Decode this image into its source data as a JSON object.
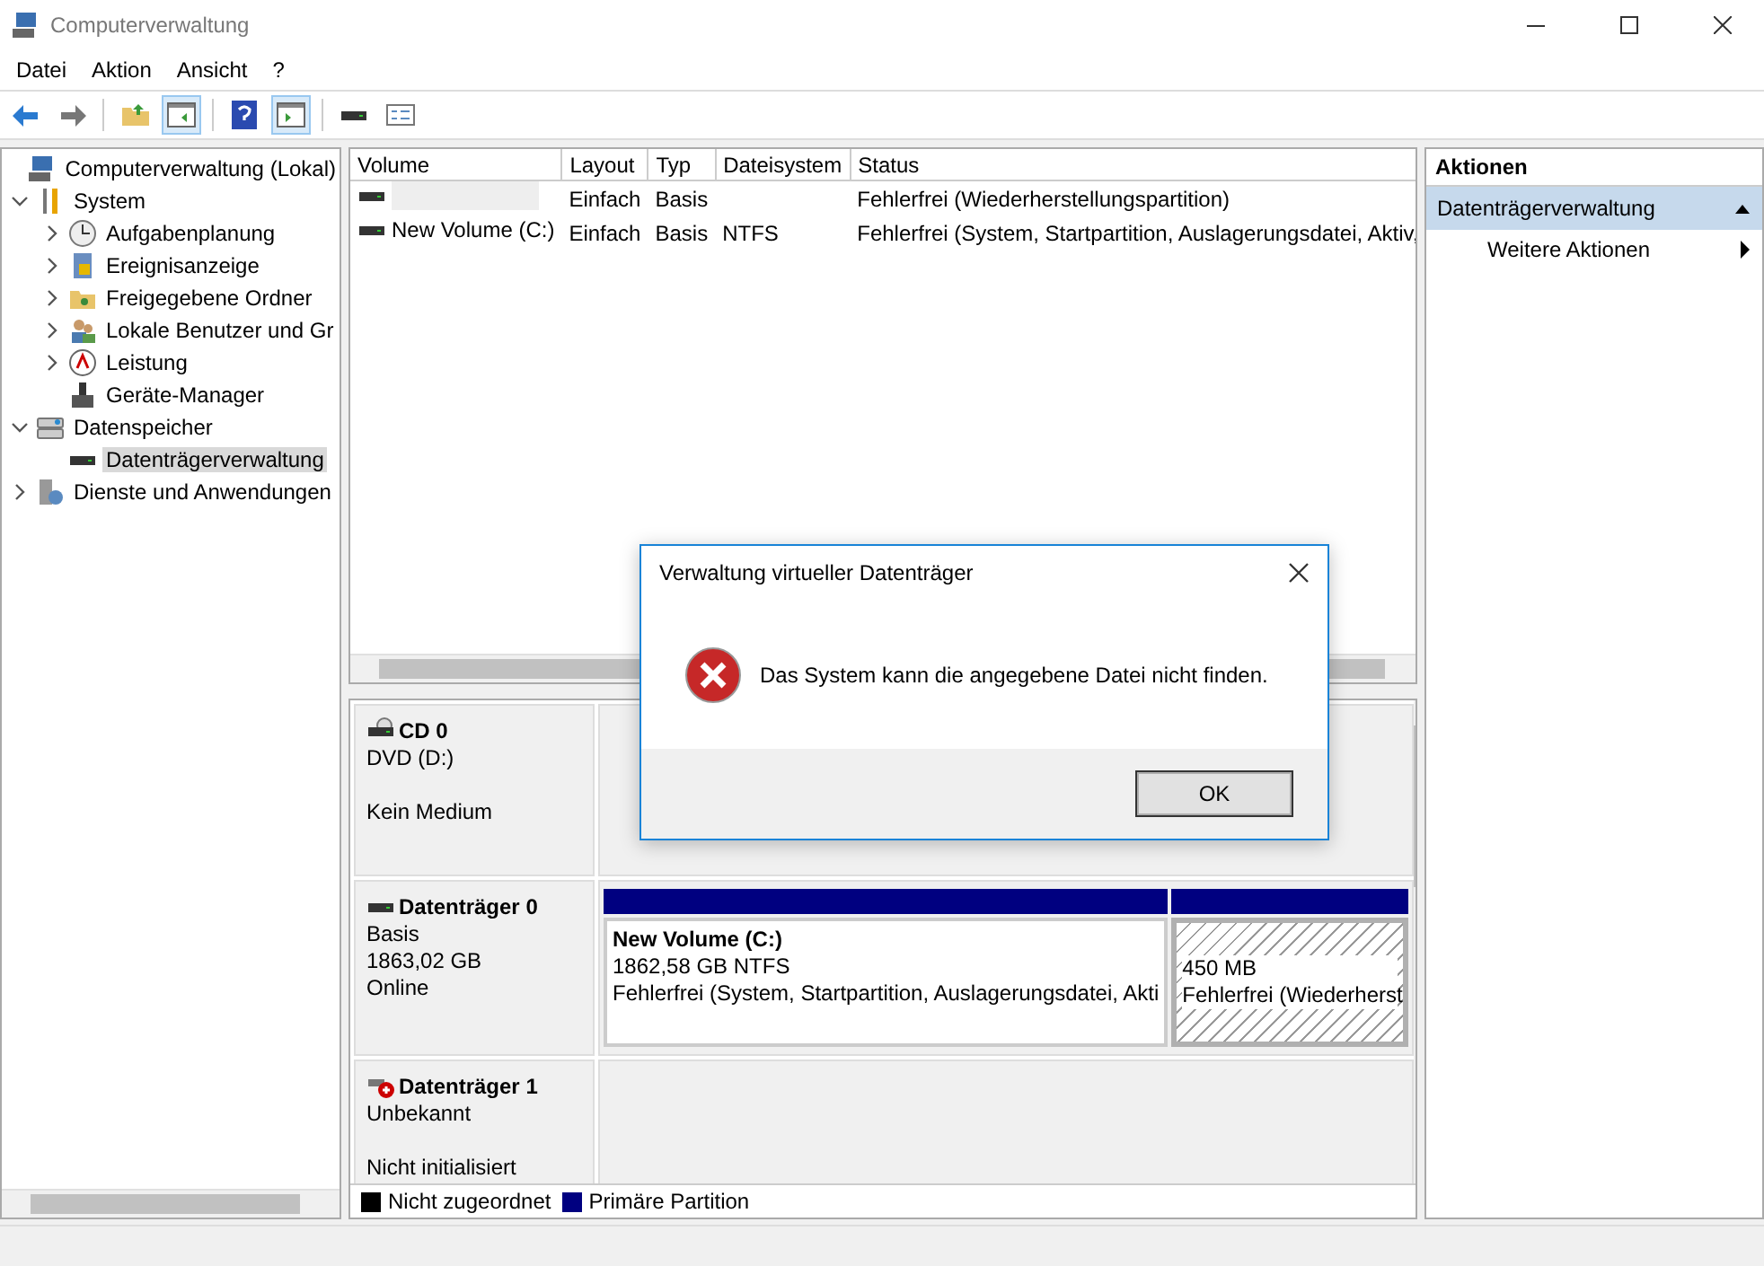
{
  "window": {
    "title": "Computerverwaltung"
  },
  "menu": [
    "Datei",
    "Aktion",
    "Ansicht",
    "?"
  ],
  "tree": [
    {
      "label": "Computerverwaltung (Lokal)",
      "selected": false,
      "children": [
        {
          "label": "System",
          "expanded": true,
          "selected": false,
          "children": [
            {
              "label": "Aufgabenplanung",
              "expanded": false,
              "selected": false
            },
            {
              "label": "Ereignisanzeige",
              "expanded": false,
              "selected": false
            },
            {
              "label": "Freigegebene Ordner",
              "expanded": false,
              "selected": false
            },
            {
              "label": "Lokale Benutzer und Gr",
              "expanded": false,
              "selected": false
            },
            {
              "label": "Leistung",
              "expanded": false,
              "selected": false
            },
            {
              "label": "Geräte-Manager",
              "selected": false
            }
          ]
        },
        {
          "label": "Datenspeicher",
          "expanded": true,
          "selected": false,
          "children": [
            {
              "label": "Datenträgerverwaltung",
              "selected": true
            }
          ]
        },
        {
          "label": "Dienste und Anwendungen",
          "expanded": false,
          "selected": false
        }
      ]
    }
  ],
  "volumes": {
    "columns": [
      "Volume",
      "Layout",
      "Typ",
      "Dateisystem",
      "Status"
    ],
    "rows": [
      {
        "cells": [
          "",
          "Einfach",
          "Basis",
          "",
          "Fehlerfrei (Wiederherstellungspartition)"
        ]
      },
      {
        "cells": [
          "New Volume (C:)",
          "Einfach",
          "Basis",
          "NTFS",
          "Fehlerfrei (System, Startpartition, Auslagerungsdatei, Aktiv,"
        ]
      }
    ]
  },
  "disks": [
    {
      "kind": "cd",
      "name": "CD 0",
      "lines": [
        "DVD (D:)",
        "Kein Medium"
      ]
    },
    {
      "kind": "disk",
      "name": "Datenträger 0",
      "lines": [
        "Basis",
        "1863,02 GB",
        "Online"
      ],
      "partitions": [
        {
          "kind": "primary",
          "title": "New Volume  (C:)",
          "lines": [
            "1862,58 GB NTFS",
            "Fehlerfrei (System, Startpartition, Auslagerungsdatei, Akti"
          ],
          "selected": false
        },
        {
          "kind": "recovery",
          "lines": [
            "450 MB",
            "Fehlerfrei (Wiederherst"
          ],
          "selected": true
        }
      ]
    },
    {
      "kind": "unknown",
      "name": "Datenträger 1",
      "lines": [
        "Unbekannt",
        "Nicht initialisiert"
      ]
    }
  ],
  "legend": [
    {
      "label": "Nicht zugeordnet",
      "color": "#000000"
    },
    {
      "label": "Primäre Partition",
      "color": "#000080"
    }
  ],
  "actions": {
    "title": "Aktionen",
    "section": "Datenträgerverwaltung",
    "items": [
      "Weitere Aktionen"
    ]
  },
  "dialog": {
    "title": "Verwaltung virtueller Datenträger",
    "message": "Das System kann die angegebene Datei nicht finden.",
    "button": "OK"
  }
}
